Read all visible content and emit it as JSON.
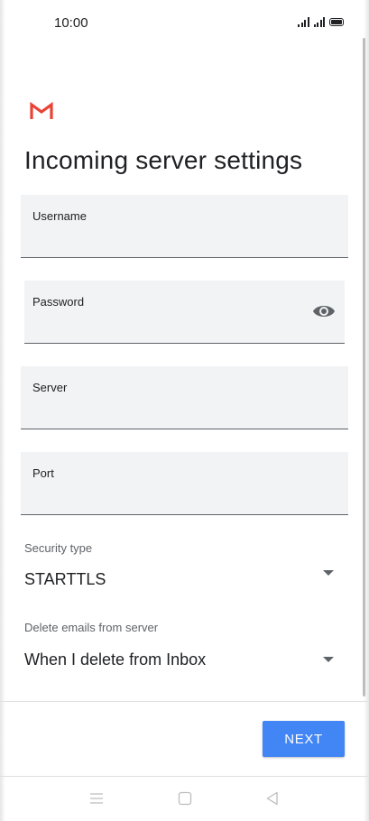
{
  "status_bar": {
    "time": "10:00",
    "icons": [
      "signal-icon",
      "signal-icon",
      "battery-icon"
    ]
  },
  "app": {
    "logo_icon": "gmail-logo",
    "brand_color": "#EA4335"
  },
  "page": {
    "title": "Incoming server settings"
  },
  "form": {
    "username_label": "Username",
    "username_value": "",
    "password_label": "Password",
    "password_value": "",
    "password_toggle_icon": "eye-icon",
    "server_label": "Server",
    "server_value": "",
    "port_label": "Port",
    "port_value": "",
    "security_type_label": "Security type",
    "security_type_value": "STARTTLS",
    "delete_emails_label": "Delete emails from server",
    "delete_emails_value": "When I delete from Inbox"
  },
  "actions": {
    "next_label": "NEXT",
    "accent_color": "#4285F4"
  },
  "nav_bar": {
    "icons": [
      "menu-icon",
      "home-icon",
      "back-icon"
    ]
  }
}
